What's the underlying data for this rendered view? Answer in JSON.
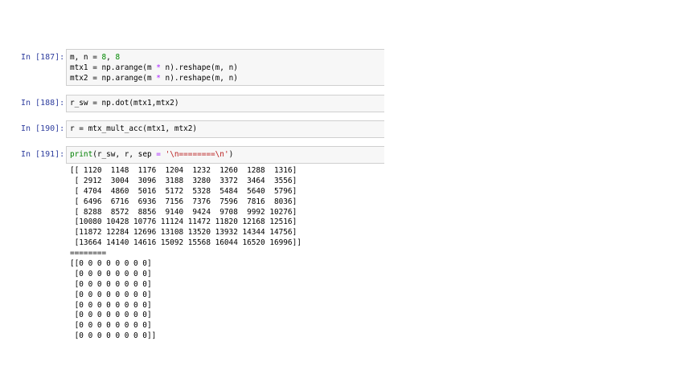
{
  "cells": [
    {
      "prompt": "In [187]:",
      "lines": [
        [
          {
            "t": "m, n = ",
            "c": ""
          },
          {
            "t": "8",
            "c": "num"
          },
          {
            "t": ", ",
            "c": ""
          },
          {
            "t": "8",
            "c": "num"
          }
        ],
        [
          {
            "t": "mtx1 = np.arange(m ",
            "c": ""
          },
          {
            "t": "*",
            "c": "op"
          },
          {
            "t": " n).reshape(m, n)",
            "c": ""
          }
        ],
        [
          {
            "t": "mtx2 = np.arange(m ",
            "c": ""
          },
          {
            "t": "*",
            "c": "op"
          },
          {
            "t": " n).reshape(m, n)",
            "c": ""
          }
        ]
      ]
    },
    {
      "prompt": "In [188]:",
      "lines": [
        [
          {
            "t": "r_sw = np.dot(mtx1,mtx2)",
            "c": ""
          }
        ]
      ]
    },
    {
      "prompt": "In [190]:",
      "lines": [
        [
          {
            "t": "r = mtx_mult_acc(mtx1, mtx2)",
            "c": ""
          }
        ]
      ]
    },
    {
      "prompt": "In [191]:",
      "lines": [
        [
          {
            "t": "print",
            "c": "kw"
          },
          {
            "t": "(r_sw, r, sep ",
            "c": ""
          },
          {
            "t": "=",
            "c": "op"
          },
          {
            "t": " ",
            "c": ""
          },
          {
            "t": "'\\n========\\n'",
            "c": "str"
          },
          {
            "t": ")",
            "c": ""
          }
        ]
      ]
    }
  ],
  "output_lines": [
    "[[ 1120  1148  1176  1204  1232  1260  1288  1316]",
    " [ 2912  3004  3096  3188  3280  3372  3464  3556]",
    " [ 4704  4860  5016  5172  5328  5484  5640  5796]",
    " [ 6496  6716  6936  7156  7376  7596  7816  8036]",
    " [ 8288  8572  8856  9140  9424  9708  9992 10276]",
    " [10080 10428 10776 11124 11472 11820 12168 12516]",
    " [11872 12284 12696 13108 13520 13932 14344 14756]",
    " [13664 14140 14616 15092 15568 16044 16520 16996]]",
    "========",
    "[[0 0 0 0 0 0 0 0]",
    " [0 0 0 0 0 0 0 0]",
    " [0 0 0 0 0 0 0 0]",
    " [0 0 0 0 0 0 0 0]",
    " [0 0 0 0 0 0 0 0]",
    " [0 0 0 0 0 0 0 0]",
    " [0 0 0 0 0 0 0 0]",
    " [0 0 0 0 0 0 0 0]]"
  ]
}
